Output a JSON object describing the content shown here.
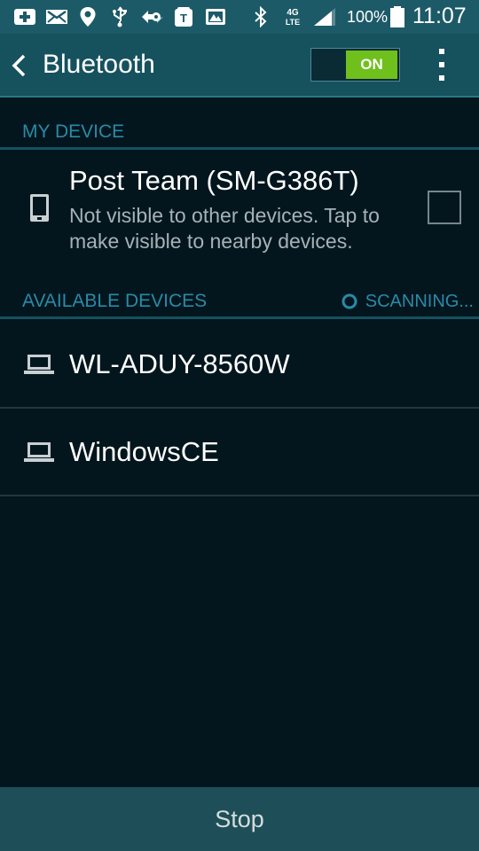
{
  "status_bar": {
    "icons": [
      "add-box-icon",
      "mail-icon",
      "location-pin-icon",
      "usb-icon",
      "sync-icon",
      "t-mobile-icon",
      "gallery-icon",
      "bluetooth-icon",
      "4g-lte-icon",
      "signal-icon",
      "battery-icon"
    ],
    "battery_text": "100%",
    "time": "11:07",
    "colors": {
      "background": "#1d5a68"
    }
  },
  "header": {
    "title": "Bluetooth",
    "toggle_label": "ON",
    "toggle_on": true,
    "colors": {
      "background": "#16515e",
      "toggle_on": "#6fc01d"
    }
  },
  "my_device": {
    "section_title": "MY DEVICE",
    "name": "Post Team (SM-G386T)",
    "description": "Not visible to other devices. Tap to make visible to nearby devices.",
    "visible_checked": false
  },
  "available": {
    "section_title": "AVAILABLE DEVICES",
    "status": "SCANNING...",
    "devices": [
      {
        "name": "WL-ADUY-8560W",
        "icon": "laptop-icon"
      },
      {
        "name": "WindowsCE",
        "icon": "laptop-icon"
      }
    ]
  },
  "footer": {
    "stop_label": "Stop"
  },
  "colors": {
    "accent": "#2a8aa7",
    "background": "#03161e",
    "divider": "#24363c"
  }
}
